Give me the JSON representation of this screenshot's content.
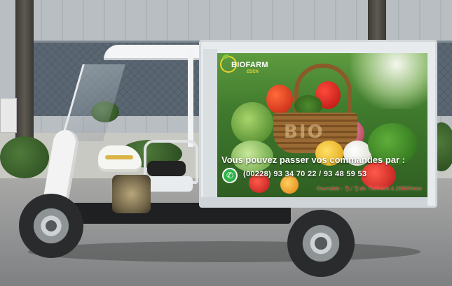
{
  "photo": {
    "subject": "Biofarm delivery tricycle",
    "colors": {
      "accent_yellow": "#e8d230",
      "whatsapp_green": "#2fb34a",
      "hours_red": "#e03a2a"
    }
  },
  "ad_panel": {
    "logo": {
      "name": "BIOFARM",
      "sub": "EDEN"
    },
    "basket_word": "BIO",
    "order_text": "Vous pouvez passer vos commandes par :",
    "whatsapp_icon": "whatsapp-icon",
    "phones": "(00228) 93 34 70 22 / 93 48 59 53",
    "hours": "Ouvrable : 7j / 7j de 7h00min à 20H00min"
  }
}
